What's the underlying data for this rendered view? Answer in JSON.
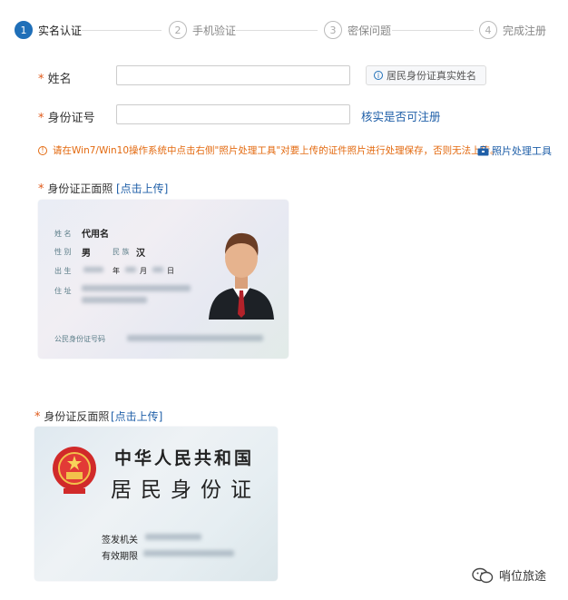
{
  "steps": [
    {
      "num": "1",
      "label": "实名认证"
    },
    {
      "num": "2",
      "label": "手机验证"
    },
    {
      "num": "3",
      "label": "密保问题"
    },
    {
      "num": "4",
      "label": "完成注册"
    }
  ],
  "form": {
    "required_mark": "*",
    "name_label": "姓名",
    "name_value": "",
    "name_hint": "居民身份证真实姓名",
    "id_label": "身份证号",
    "id_value": "",
    "id_link": "核实是否可注册"
  },
  "warning": {
    "text": "请在Win7/Win10操作系统中点击右侧\"照片处理工具\"对要上传的证件照片进行处理保存，否则无法上传。",
    "tool_label": "照片处理工具"
  },
  "front": {
    "label": "身份证正面照",
    "upload": "[点击上传]",
    "card": {
      "name_title": "姓 名",
      "name_value": "代用名",
      "sex_title": "性 别",
      "sex_value": "男",
      "ethnic_title": "民 族",
      "ethnic_value": "汉",
      "birth_title": "出 生",
      "year_unit": "年",
      "month_unit": "月",
      "day_unit": "日",
      "address_title": "住 址",
      "id_title": "公民身份证号码"
    }
  },
  "back": {
    "label": "身份证反面照",
    "upload": "[点击上传]",
    "card": {
      "country": "中华人民共和国",
      "title": "居民身份证",
      "authority_title": "签发机关",
      "valid_title": "有效期限"
    }
  },
  "watermark": {
    "name": "哨位旅途"
  },
  "colors": {
    "accent": "#1f6fb8",
    "warning": "#e36a10",
    "link": "#1f5fa8"
  }
}
